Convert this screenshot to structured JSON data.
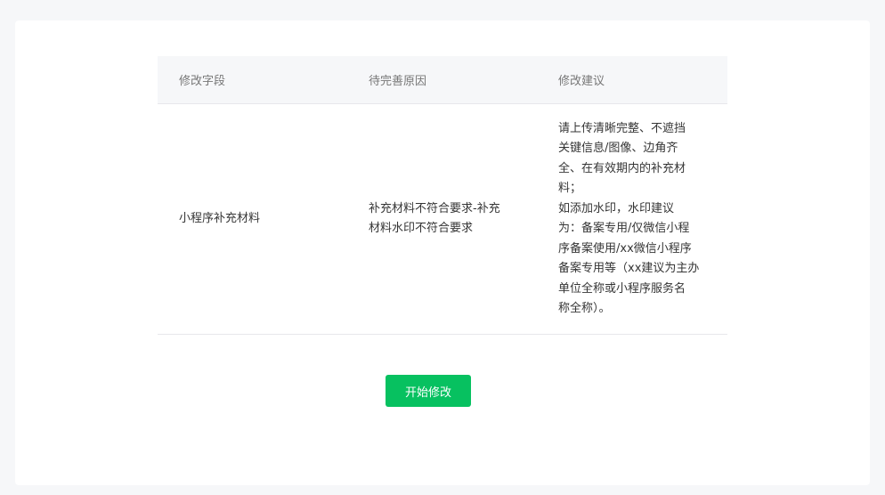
{
  "table": {
    "headers": [
      "修改字段",
      "待完善原因",
      "修改建议"
    ],
    "rows": [
      {
        "field": "小程序补充材料",
        "reason_lines": [
          "补充材料不符合要求-补充",
          "材料水印不符合要求"
        ],
        "suggestion_lines": [
          "请上传清晰完整、不遮挡",
          "关键信息/图像、边角齐",
          "全、在有效期内的补充材",
          "料；",
          "如添加水印，水印建议",
          "为：备案专用/仅微信小程",
          "序备案使用/xx微信小程序",
          "备案专用等（xx建议为主办",
          "单位全称或小程序服务名",
          "称全称）。"
        ]
      }
    ]
  },
  "actions": {
    "start_label": "开始修改"
  },
  "colors": {
    "accent": "#07c160",
    "page_bg": "#f6f7f9",
    "header_bg": "#f6f7f9"
  }
}
